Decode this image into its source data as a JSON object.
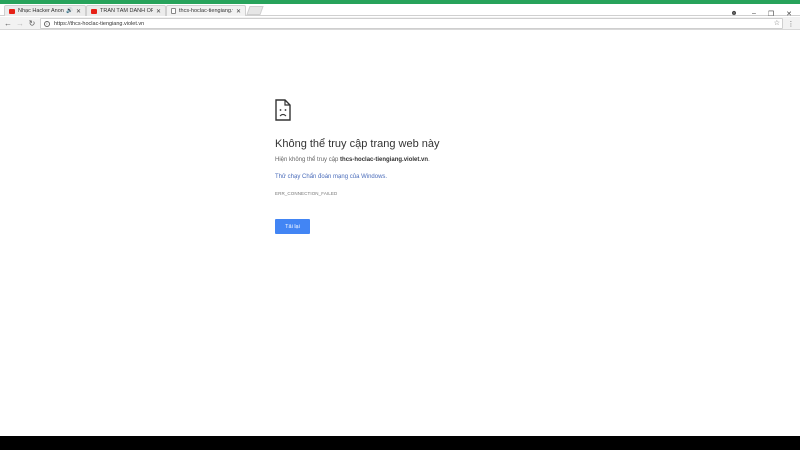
{
  "browser": {
    "tabs": [
      {
        "title": "Nhạc Hacker Anonym",
        "favicon": "youtube-icon",
        "audio": "🔊",
        "active": false
      },
      {
        "title": "TRẦN TÂM DANH OFFIC",
        "favicon": "youtube-icon",
        "audio": "",
        "active": false
      },
      {
        "title": "thcs-hoclac-tiengiang.vi",
        "favicon": "page-icon",
        "audio": "",
        "active": true
      }
    ],
    "close_glyph": "✕",
    "window_controls": {
      "profile": "☻",
      "minimize": "–",
      "maximize": "❐",
      "close": "✕"
    },
    "nav": {
      "back": "←",
      "forward": "→",
      "reload": "↻"
    },
    "url": "https://thcs-hoclac-tiengiang.violet.vn",
    "star": "☆",
    "menu": "⋮",
    "accent_color": "#27a35b"
  },
  "error_page": {
    "title": "Không thể truy cập trang web này",
    "message_prefix": "Hiện không thể truy cập ",
    "host": "thcs-hoclac-tiengiang.violet.vn",
    "message_suffix": ".",
    "suggestion": "Thử chạy Chẩn đoán mạng của Windows.",
    "error_code": "ERR_CONNECTION_FAILED",
    "reload_label": "Tải lại",
    "button_color": "#4285f4"
  }
}
